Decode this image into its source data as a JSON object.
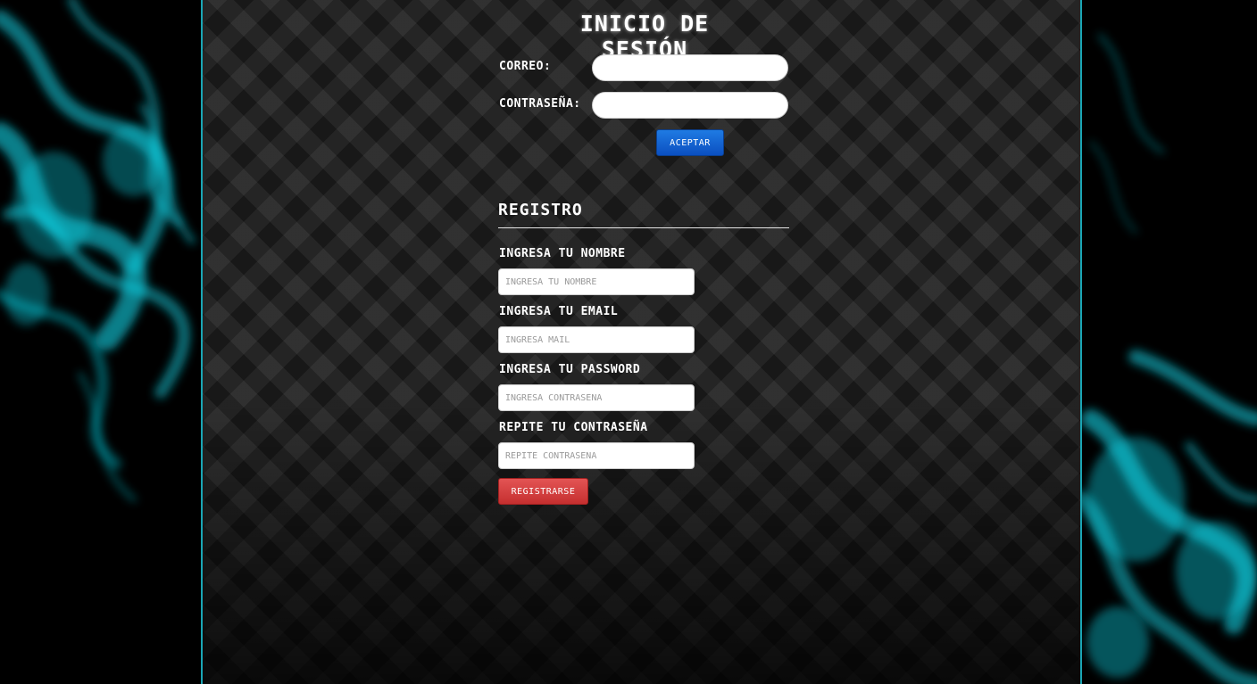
{
  "theme": {
    "accent": "#1aa6b5",
    "smoke": "#10d4e6",
    "accept_button": "#0b5fd0",
    "register_button": "#d93f3f"
  },
  "login": {
    "title": "INICIO DE SESIÓN",
    "email_label": "CORREO:",
    "email_value": "",
    "password_label": "CONTRASEÑA:",
    "password_value": "",
    "accept_label": "ACEPTAR"
  },
  "register": {
    "title": "REGISTRO",
    "fields": [
      {
        "label": "INGRESA TU NOMBRE",
        "placeholder": "INGRESA TU NOMBRE",
        "value": ""
      },
      {
        "label": "INGRESA TU EMAIL",
        "placeholder": "INGRESA MAIL",
        "value": ""
      },
      {
        "label": "INGRESA TU PASSWORD",
        "placeholder": "INGRESA CONTRASEÑA",
        "value": ""
      },
      {
        "label": "REPITE TU CONTRASEÑA",
        "placeholder": "REPITE CONTRASEÑA",
        "value": ""
      }
    ],
    "submit_label": "REGISTRARSE"
  }
}
